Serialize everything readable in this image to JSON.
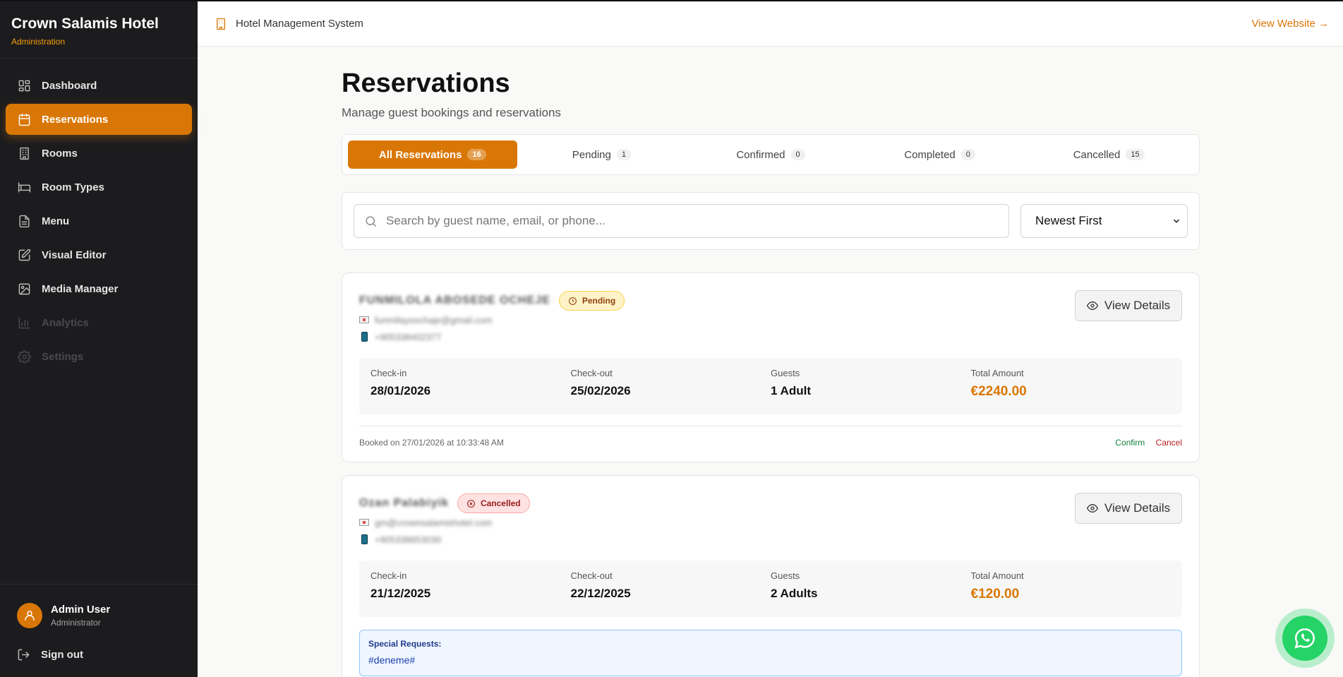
{
  "brand": {
    "title": "Crown Salamis Hotel",
    "subtitle": "Administration"
  },
  "nav": [
    {
      "label": "Dashboard",
      "icon": "dashboard-icon",
      "state": "normal"
    },
    {
      "label": "Reservations",
      "icon": "calendar-icon",
      "state": "active"
    },
    {
      "label": "Rooms",
      "icon": "building-icon",
      "state": "normal"
    },
    {
      "label": "Room Types",
      "icon": "bed-icon",
      "state": "normal"
    },
    {
      "label": "Menu",
      "icon": "document-icon",
      "state": "normal"
    },
    {
      "label": "Visual Editor",
      "icon": "edit-icon",
      "state": "normal"
    },
    {
      "label": "Media Manager",
      "icon": "image-icon",
      "state": "normal"
    },
    {
      "label": "Analytics",
      "icon": "chart-icon",
      "state": "disabled"
    },
    {
      "label": "Settings",
      "icon": "gear-icon",
      "state": "disabled"
    }
  ],
  "user": {
    "name": "Admin User",
    "role": "Administrator",
    "signout": "Sign out"
  },
  "topbar": {
    "title": "Hotel Management System",
    "view_website": "View Website →"
  },
  "page": {
    "title": "Reservations",
    "subtitle": "Manage guest bookings and reservations"
  },
  "tabs": [
    {
      "label": "All Reservations",
      "count": "16",
      "active": true
    },
    {
      "label": "Pending",
      "count": "1",
      "active": false
    },
    {
      "label": "Confirmed",
      "count": "0",
      "active": false
    },
    {
      "label": "Completed",
      "count": "0",
      "active": false
    },
    {
      "label": "Cancelled",
      "count": "15",
      "active": false
    }
  ],
  "filters": {
    "search_placeholder": "Search by guest name, email, or phone...",
    "sort_value": "Newest First"
  },
  "reservations": [
    {
      "guest": "FUNMILOLA ABOSEDE OCHEJE",
      "status": "Pending",
      "email": "funmilayoochaje@gmail.com",
      "phone": "+905338402377",
      "view_label": "View Details",
      "checkin_label": "Check-in",
      "checkin": "28/01/2026",
      "checkout_label": "Check-out",
      "checkout": "25/02/2026",
      "guests_label": "Guests",
      "guests": "1 Adult",
      "amount_label": "Total Amount",
      "amount": "€2240.00",
      "booked": "Booked on 27/01/2026 at 10:33:48 AM",
      "confirm": "Confirm",
      "cancel": "Cancel"
    },
    {
      "guest": "Ozan Palabiyik",
      "status": "Cancelled",
      "email": "gm@crownsalamishotel.com",
      "phone": "+905338653030",
      "view_label": "View Details",
      "checkin_label": "Check-in",
      "checkin": "21/12/2025",
      "checkout_label": "Check-out",
      "checkout": "22/12/2025",
      "guests_label": "Guests",
      "guests": "2 Adults",
      "amount_label": "Total Amount",
      "amount": "€120.00",
      "requests_label": "Special Requests:",
      "requests": "#deneme#"
    }
  ]
}
